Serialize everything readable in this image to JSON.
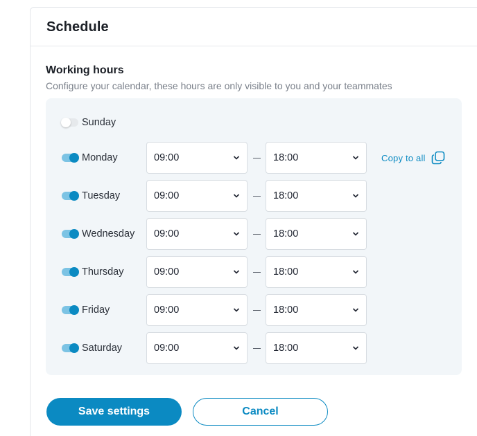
{
  "card": {
    "title": "Schedule"
  },
  "working_hours": {
    "title": "Working hours",
    "subtitle": "Configure your calendar, these hours are only visible to you and your teammates"
  },
  "days": [
    {
      "label": "Sunday",
      "enabled": false,
      "start": "",
      "end": ""
    },
    {
      "label": "Monday",
      "enabled": true,
      "start": "09:00",
      "end": "18:00"
    },
    {
      "label": "Tuesday",
      "enabled": true,
      "start": "09:00",
      "end": "18:00"
    },
    {
      "label": "Wednesday",
      "enabled": true,
      "start": "09:00",
      "end": "18:00"
    },
    {
      "label": "Thursday",
      "enabled": true,
      "start": "09:00",
      "end": "18:00"
    },
    {
      "label": "Friday",
      "enabled": true,
      "start": "09:00",
      "end": "18:00"
    },
    {
      "label": "Saturday",
      "enabled": true,
      "start": "09:00",
      "end": "18:00"
    }
  ],
  "copy_to_all": {
    "label": "Copy to all",
    "icon": "copy-icon"
  },
  "actions": {
    "save_label": "Save settings",
    "cancel_label": "Cancel"
  },
  "colors": {
    "accent": "#0b8ac2",
    "panel_bg": "#f2f6f9",
    "toggle_track_on": "#7cc3e4"
  }
}
